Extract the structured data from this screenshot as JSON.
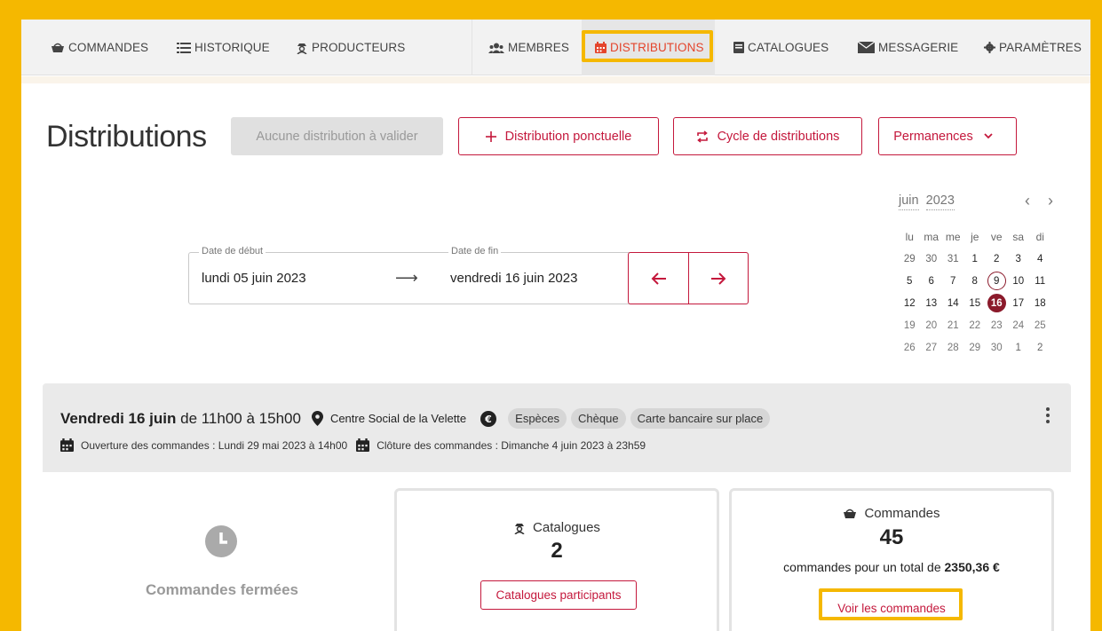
{
  "nav": {
    "commandes": "COMMANDES",
    "historique": "HISTORIQUE",
    "producteurs": "PRODUCTEURS",
    "membres": "MEMBRES",
    "distributions": "DISTRIBUTIONS",
    "catalogues": "CATALOGUES",
    "messagerie": "MESSAGERIE",
    "parametres": "PARAMÈTRES"
  },
  "header": {
    "title": "Distributions",
    "validate_label": "Aucune distribution à valider",
    "ponctuelle_label": "Distribution ponctuelle",
    "cycle_label": "Cycle de distributions",
    "permanences_label": "Permanences"
  },
  "range": {
    "start_legend": "Date de début",
    "start_value": "lundi 05 juin 2023",
    "end_legend": "Date de fin",
    "end_value": "vendredi 16 juin 2023"
  },
  "calendar": {
    "month": "juin",
    "year": "2023",
    "weekdays": [
      "lu",
      "ma",
      "me",
      "je",
      "ve",
      "sa",
      "di"
    ],
    "weeks": [
      [
        "29",
        "30",
        "31",
        "1",
        "2",
        "3",
        "4"
      ],
      [
        "5",
        "6",
        "7",
        "8",
        "9",
        "10",
        "11"
      ],
      [
        "12",
        "13",
        "14",
        "15",
        "16",
        "17",
        "18"
      ],
      [
        "19",
        "20",
        "21",
        "22",
        "23",
        "24",
        "25"
      ],
      [
        "26",
        "27",
        "28",
        "29",
        "30",
        "1",
        "2"
      ]
    ],
    "today": "9",
    "selected": "16"
  },
  "distribution": {
    "day": "Vendredi 16 juin",
    "hours": "de 11h00 à 15h00",
    "location": "Centre Social de la Velette",
    "payments": [
      "Espèces",
      "Chèque",
      "Carte bancaire sur place"
    ],
    "opening": "Ouverture des commandes : Lundi 29 mai 2023 à 14h00",
    "closing": "Clôture des commandes : Dimanche 4 juin 2023 à 23h59",
    "status": "Commandes fermées",
    "catalogues_title": "Catalogues",
    "catalogues_count": "2",
    "catalogues_button": "Catalogues participants",
    "orders_title": "Commandes",
    "orders_count": "45",
    "orders_text": "commandes pour un total de",
    "orders_total": "2350,36 €",
    "orders_button": "Voir les commandes"
  },
  "colors": {
    "accent": "#c4183c",
    "highlight": "#f5b800",
    "active_nav": "#e4452c",
    "selected_day": "#8b1a2b"
  }
}
